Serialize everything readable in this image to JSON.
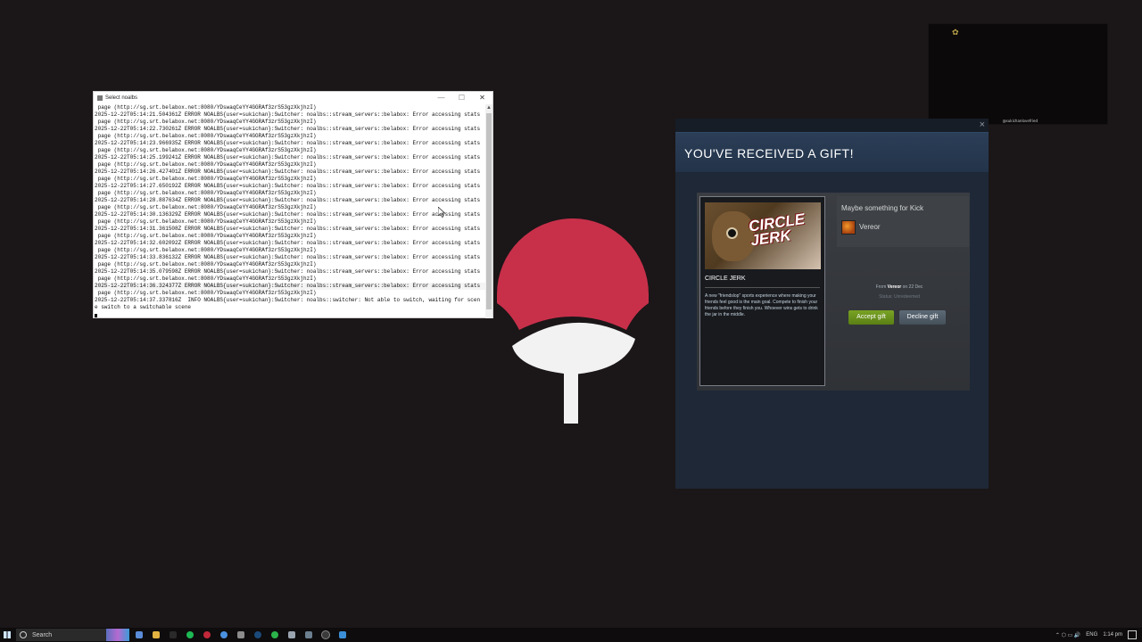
{
  "console": {
    "title": "Select noalbs",
    "minimize": "—",
    "maximize": "☐",
    "close": "✕",
    "lines": [
      " page (http://sg.srt.belabox.net:8080/YDswaqCeYY4GGRAf3zrS53gzXkjhzI)",
      "2025-12-22T05:14:21.504361Z ERROR NOALBS{user=sukichan}:Switcher: noalbs::stream_servers::belabox: Error accessing stats",
      " page (http://sg.srt.belabox.net:8080/YDswaqCeYY4GGRAf3zrS53gzXkjhzI)",
      "2025-12-22T05:14:22.730261Z ERROR NOALBS{user=sukichan}:Switcher: noalbs::stream_servers::belabox: Error accessing stats",
      " page (http://sg.srt.belabox.net:8080/YDswaqCeYY4GGRAf3zrS53gzXkjhzI)",
      "2025-12-22T05:14:23.966935Z ERROR NOALBS{user=sukichan}:Switcher: noalbs::stream_servers::belabox: Error accessing stats",
      " page (http://sg.srt.belabox.net:8080/YDswaqCeYY4GGRAf3zrS53gzXkjhzI)",
      "2025-12-22T05:14:25.199241Z ERROR NOALBS{user=sukichan}:Switcher: noalbs::stream_servers::belabox: Error accessing stats",
      " page (http://sg.srt.belabox.net:8080/YDswaqCeYY4GGRAf3zrS53gzXkjhzI)",
      "2025-12-22T05:14:26.427401Z ERROR NOALBS{user=sukichan}:Switcher: noalbs::stream_servers::belabox: Error accessing stats",
      " page (http://sg.srt.belabox.net:8080/YDswaqCeYY4GGRAf3zrS53gzXkjhzI)",
      "2025-12-22T05:14:27.650192Z ERROR NOALBS{user=sukichan}:Switcher: noalbs::stream_servers::belabox: Error accessing stats",
      " page (http://sg.srt.belabox.net:8080/YDswaqCeYY4GGRAf3zrS53gzXkjhzI)",
      "2025-12-22T05:14:28.887634Z ERROR NOALBS{user=sukichan}:Switcher: noalbs::stream_servers::belabox: Error accessing stats",
      " page (http://sg.srt.belabox.net:8080/YDswaqCeYY4GGRAf3zrS53gzXkjhzI)",
      "2025-12-22T05:14:30.136329Z ERROR NOALBS{user=sukichan}:Switcher: noalbs::stream_servers::belabox: Error accessing stats",
      " page (http://sg.srt.belabox.net:8080/YDswaqCeYY4GGRAf3zrS53gzXkjhzI)",
      "2025-12-22T05:14:31.361508Z ERROR NOALBS{user=sukichan}:Switcher: noalbs::stream_servers::belabox: Error accessing stats",
      " page (http://sg.srt.belabox.net:8080/YDswaqCeYY4GGRAf3zrS53gzXkjhzI)",
      "2025-12-22T05:14:32.602092Z ERROR NOALBS{user=sukichan}:Switcher: noalbs::stream_servers::belabox: Error accessing stats",
      " page (http://sg.srt.belabox.net:8080/YDswaqCeYY4GGRAf3zrS53gzXkjhzI)",
      "2025-12-22T05:14:33.836132Z ERROR NOALBS{user=sukichan}:Switcher: noalbs::stream_servers::belabox: Error accessing stats",
      " page (http://sg.srt.belabox.net:8080/YDswaqCeYY4GGRAf3zrS53gzXkjhzI)",
      "2025-12-22T05:14:35.079598Z ERROR NOALBS{user=sukichan}:Switcher: noalbs::stream_servers::belabox: Error accessing stats",
      " page (http://sg.srt.belabox.net:8080/YDswaqCeYY4GGRAf3zrS53gzXkjhzI)",
      "2025-12-22T05:14:36.324377Z ERROR NOALBS{user=sukichan}:Switcher: noalbs::stream_servers::belabox: Error accessing stats",
      " page (http://sg.srt.belabox.net:8080/YDswaqCeYY4GGRAf3zrS53gzXkjhzI)",
      "2025-12-22T05:14:37.337816Z  INFO NOALBS{user=sukichan}:Switcher: noalbs::switcher: Not able to switch, waiting for scen",
      "e switch to a switchable scene"
    ]
  },
  "gift": {
    "close": "×",
    "heading": "YOU'VE RECEIVED A GIFT!",
    "capsule_text": "CIRCLE JERK",
    "game_name": "CIRCLE JERK",
    "description": "A new \"friendslop\" sports experience where making your friends feel good is the main goal. Compete to finish your friends before they finish you. Whoever wins gets to drink the jar in the middle.",
    "message": "Maybe something for Kick",
    "sender": "Vereor",
    "from_prefix": "From ",
    "from_name": "Vereor",
    "from_suffix": " on 22 Dec",
    "status": "Status: Unredeemed",
    "accept_label": "Accept gift",
    "decline_label": "Decline gift",
    "colors": {
      "accent_green": "#79a325",
      "header_blue": "#2b3e57"
    }
  },
  "mini_preview": {
    "label": "@sukichanlovefried",
    "deco_icon": "✿"
  },
  "taskbar": {
    "search_placeholder": "Search",
    "tray_language": "ENG",
    "tray_time": "1:14 pm",
    "tray_glyphs": "⌃  ⬡  ▭  🔊"
  }
}
